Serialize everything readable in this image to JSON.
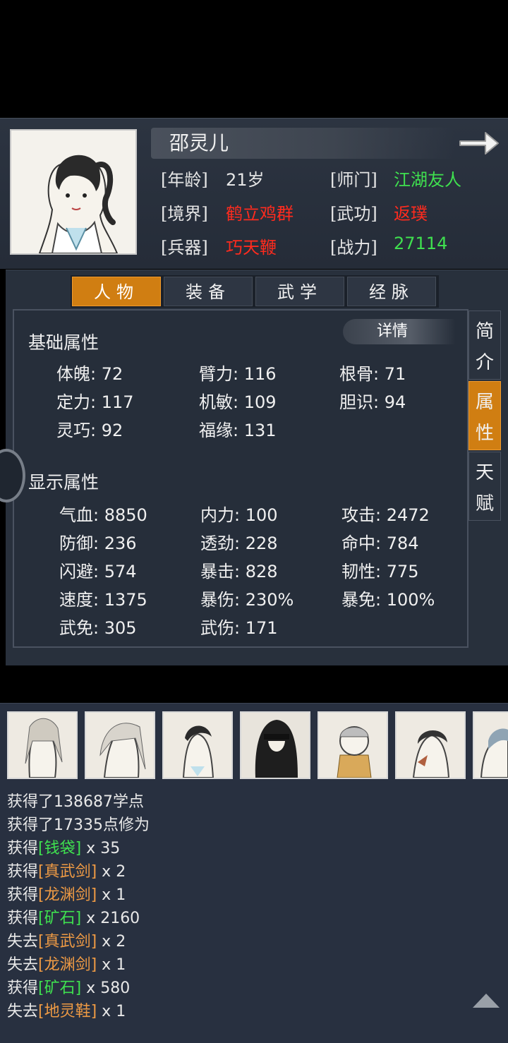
{
  "character": {
    "name": "邵灵儿",
    "info": [
      {
        "label": "[年龄]",
        "value": "21岁",
        "color": "#e6e6e6"
      },
      {
        "label": "[师门]",
        "value": "江湖友人",
        "color": "#3fe04f"
      },
      {
        "label": "[境界]",
        "value": "鹤立鸡群",
        "color": "#ff2b1e"
      },
      {
        "label": "[武功]",
        "value": "返璞",
        "color": "#ff2b1e"
      },
      {
        "label": "[兵器]",
        "value": "巧天鞭",
        "color": "#ff2b1e"
      },
      {
        "label": "[战力]",
        "value": "27114",
        "color": "#3fe04f"
      }
    ]
  },
  "tabs": [
    "人物",
    "装备",
    "武学",
    "经脉"
  ],
  "side_tabs": [
    "简介",
    "属性",
    "天赋"
  ],
  "basic": {
    "title": "基础属性",
    "detail": "详情",
    "stats": [
      "体魄: 72",
      "臂力: 116",
      "根骨: 71",
      "定力: 117",
      "机敏: 109",
      "胆识: 94",
      "灵巧: 92",
      "福缘: 131"
    ]
  },
  "display": {
    "title": "显示属性",
    "stats": [
      "气血: 8850",
      "内力: 100",
      "攻击: 2472",
      "防御: 236",
      "透劲: 228",
      "命中: 784",
      "闪避: 574",
      "暴击: 828",
      "韧性: 775",
      "速度: 1375",
      "暴伤: 230%",
      "暴免: 100%",
      "武免: 305",
      "武伤: 171"
    ]
  },
  "log": [
    {
      "pre": "获得了138687学点",
      "item": "",
      "post": "",
      "color": ""
    },
    {
      "pre": "获得了17335点修为",
      "item": "",
      "post": "",
      "color": ""
    },
    {
      "pre": "获得",
      "item": "[钱袋]",
      "post": " x 35",
      "color": "g"
    },
    {
      "pre": "获得",
      "item": "[真武剑]",
      "post": " x 2",
      "color": "o"
    },
    {
      "pre": "获得",
      "item": "[龙渊剑]",
      "post": " x 1",
      "color": "o"
    },
    {
      "pre": "获得",
      "item": "[矿石]",
      "post": " x 2160",
      "color": "g"
    },
    {
      "pre": "失去",
      "item": "[真武剑]",
      "post": " x 2",
      "color": "o"
    },
    {
      "pre": "失去",
      "item": "[龙渊剑]",
      "post": " x 1",
      "color": "o"
    },
    {
      "pre": "获得",
      "item": "[矿石]",
      "post": " x 580",
      "color": "g"
    },
    {
      "pre": "失去",
      "item": "[地灵鞋]",
      "post": " x 1",
      "color": "o"
    }
  ],
  "icons": [
    "portrait-image",
    "next-arrow-icon",
    "scroll-up-icon"
  ]
}
